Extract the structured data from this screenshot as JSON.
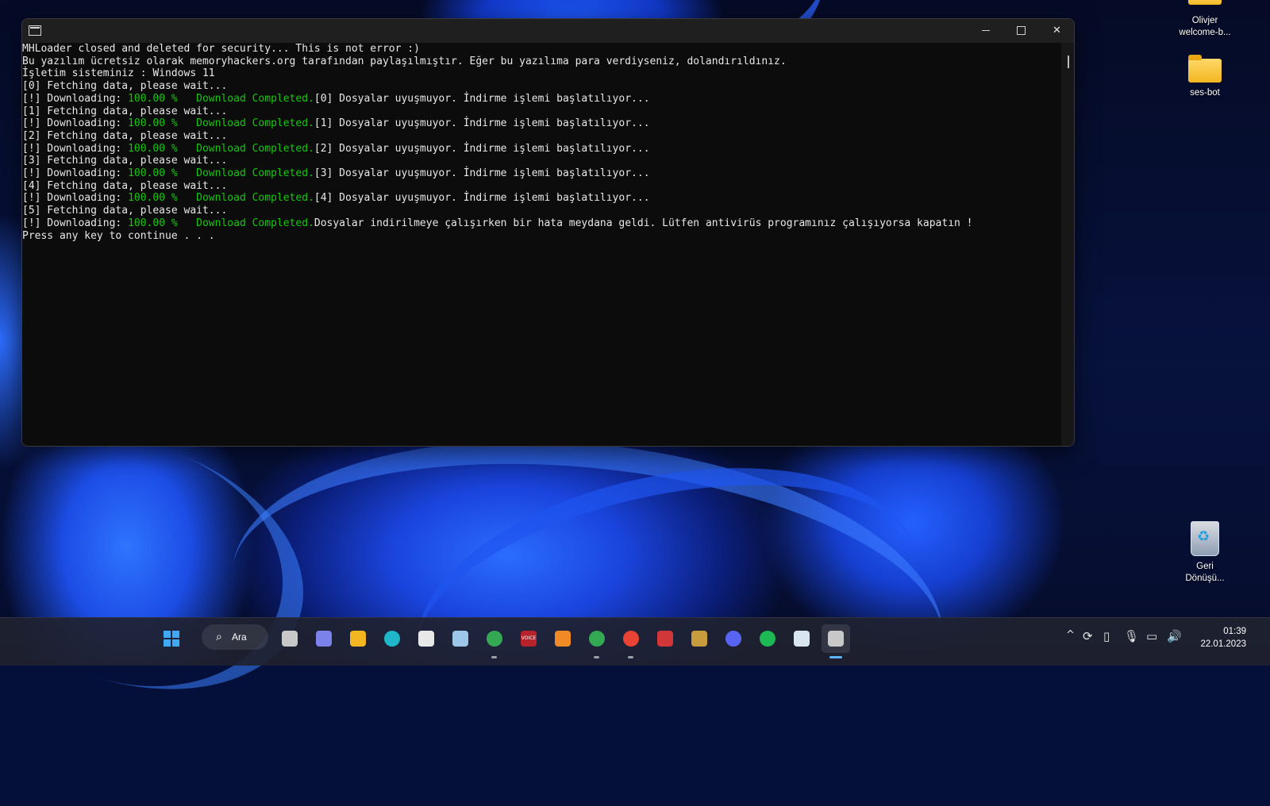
{
  "console": {
    "lines": [
      [
        {
          "t": "MHLoader closed and deleted for security... This is not error :)"
        }
      ],
      [
        {
          "t": "Bu yazılım ücretsiz olarak memoryhackers.org tarafından paylaşılmıştır. Eğer bu yazılıma para verdiyseniz, dolandırıldınız."
        }
      ],
      [
        {
          "t": "İşletim sisteminiz : Windows 11"
        }
      ],
      [
        {
          "t": "[0] Fetching data, please wait..."
        }
      ],
      [
        {
          "t": "[!] Downloading: "
        },
        {
          "t": "100.00 %   Download Completed.",
          "c": "green"
        },
        {
          "t": "[0] Dosyalar uyuşmuyor. İndirme işlemi başlatılıyor..."
        }
      ],
      [
        {
          "t": "[1] Fetching data, please wait..."
        }
      ],
      [
        {
          "t": "[!] Downloading: "
        },
        {
          "t": "100.00 %   Download Completed.",
          "c": "green"
        },
        {
          "t": "[1] Dosyalar uyuşmuyor. İndirme işlemi başlatılıyor..."
        }
      ],
      [
        {
          "t": "[2] Fetching data, please wait..."
        }
      ],
      [
        {
          "t": "[!] Downloading: "
        },
        {
          "t": "100.00 %   Download Completed.",
          "c": "green"
        },
        {
          "t": "[2] Dosyalar uyuşmuyor. İndirme işlemi başlatılıyor..."
        }
      ],
      [
        {
          "t": "[3] Fetching data, please wait..."
        }
      ],
      [
        {
          "t": "[!] Downloading: "
        },
        {
          "t": "100.00 %   Download Completed.",
          "c": "green"
        },
        {
          "t": "[3] Dosyalar uyuşmuyor. İndirme işlemi başlatılıyor..."
        }
      ],
      [
        {
          "t": "[4] Fetching data, please wait..."
        }
      ],
      [
        {
          "t": "[!] Downloading: "
        },
        {
          "t": "100.00 %   Download Completed.",
          "c": "green"
        },
        {
          "t": "[4] Dosyalar uyuşmuyor. İndirme işlemi başlatılıyor..."
        }
      ],
      [
        {
          "t": "[5] Fetching data, please wait..."
        }
      ],
      [
        {
          "t": "[!] Downloading: "
        },
        {
          "t": "100.00 %   Download Completed.",
          "c": "green"
        },
        {
          "t": "Dosyalar indirilmeye çalışırken bir hata meydana geldi. Lütfen antivirüs programınız çalışıyorsa kapatın !"
        }
      ],
      [
        {
          "t": "Press any key to continue . . ."
        }
      ]
    ]
  },
  "window": {
    "icon": "console-app-icon",
    "controls": {
      "minimize_icon": "minimize-icon",
      "maximize_icon": "maximize-icon",
      "close_icon": "close-icon",
      "close_glyph": "✕"
    }
  },
  "desktop": {
    "icons": [
      {
        "name": "olivjer-welcome-shortcut",
        "label": "Olivjer\nwelcome-b..."
      },
      {
        "name": "ses-bot-folder",
        "label": "ses-bot"
      },
      {
        "name": "recycle-bin",
        "label": "Geri\nDönüşü..."
      }
    ]
  },
  "taskbar": {
    "search_label": "Ara",
    "apps": [
      {
        "name": "task-view-icon",
        "color": "#c8c8c8"
      },
      {
        "name": "teams-chat-icon",
        "color": "#7b83eb"
      },
      {
        "name": "file-explorer-icon",
        "color": "#f2b620"
      },
      {
        "name": "edge-icon",
        "color": "#1fb6c9"
      },
      {
        "name": "microsoft-store-icon",
        "color": "#e8e8e8"
      },
      {
        "name": "resource-monitor-icon",
        "color": "#9cc7e8"
      },
      {
        "name": "chrome-profile-icon",
        "color": "#34a853",
        "running": true
      },
      {
        "name": "voicemeeter-icon",
        "color": "#b8222a",
        "label": "VOICE"
      },
      {
        "name": "fl-studio-icon",
        "color": "#f08a24"
      },
      {
        "name": "chrome-dev-icon",
        "color": "#34a853",
        "running": true
      },
      {
        "name": "chrome-icon",
        "color": "#ea4335",
        "running": true
      },
      {
        "name": "valorant-icon",
        "color": "#d13639"
      },
      {
        "name": "league-of-legends-icon",
        "color": "#c89b3c"
      },
      {
        "name": "discord-icon",
        "color": "#5865f2"
      },
      {
        "name": "spotify-icon",
        "color": "#1db954"
      },
      {
        "name": "notepad-app-icon",
        "color": "#d9e6ef"
      },
      {
        "name": "console-taskbar-icon",
        "color": "#c8c8c8",
        "active": true
      }
    ],
    "tray": {
      "chevron": "^",
      "sync_icon": "sync-icon",
      "usb_icon": "usb-icon",
      "mic_icon": "microphone-icon",
      "network_icon": "network-icon",
      "volume_icon": "volume-icon"
    },
    "clock": {
      "time": "01:39",
      "date": "22.01.2023"
    }
  }
}
